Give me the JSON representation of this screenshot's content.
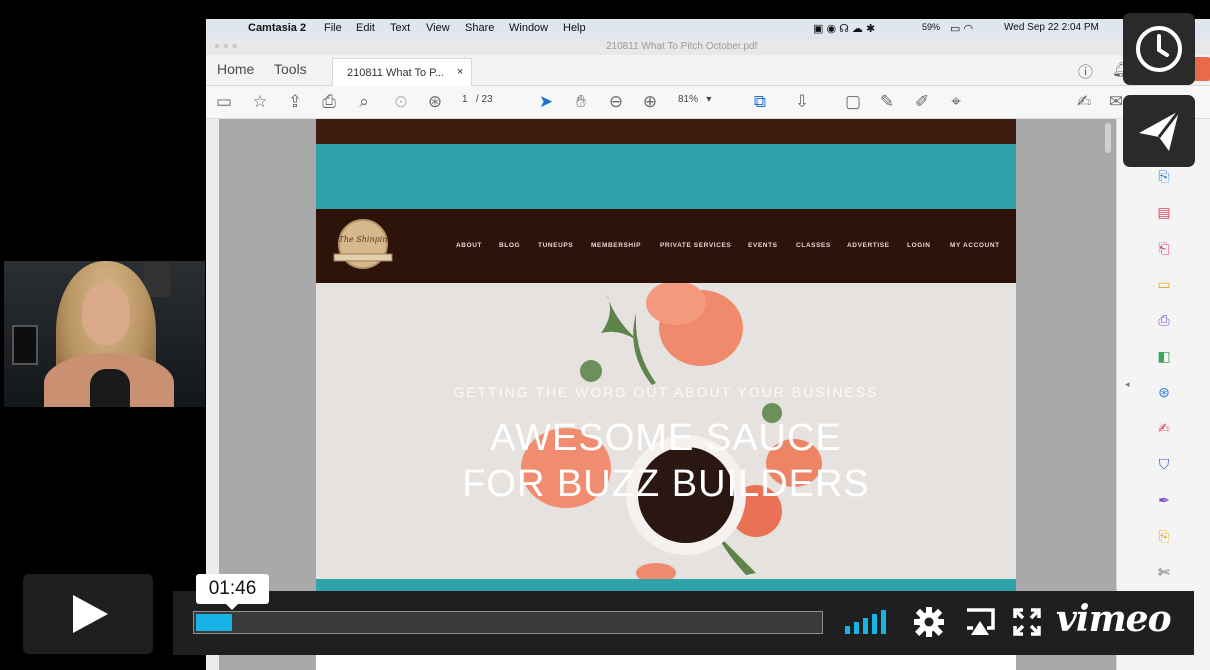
{
  "player": {
    "time_tooltip": "01:46",
    "progress": 0.057,
    "brand": "vimeo",
    "accent_color": "#17b3e6",
    "icons": [
      "play-icon",
      "volume-icon",
      "settings-icon",
      "airplay-icon",
      "fullscreen-icon",
      "clock-icon",
      "send-icon"
    ]
  },
  "mac_menubar": {
    "app": "Camtasia 2",
    "menus": [
      "File",
      "Edit",
      "Text",
      "View",
      "Share",
      "Window",
      "Help"
    ],
    "battery": "59%",
    "clock": "Wed Sep 22  2:04 PM"
  },
  "acrobat": {
    "window_title": "210811 What To Pitch October.pdf",
    "nav": [
      "Home",
      "Tools"
    ],
    "tab_label": "210811 What To P...",
    "tab_close": "×",
    "page_current": "1",
    "page_total": "/ 23",
    "zoom": "81%"
  },
  "pdf_page": {
    "nav_links": [
      "ABOUT",
      "BLOG",
      "TUNEUPS",
      "MEMBERSHIP",
      "PRIVATE SERVICES",
      "EVENTS",
      "CLASSES",
      "ADVERTISE",
      "LOGIN",
      "MY ACCOUNT"
    ],
    "logo_text": "The Shinpin",
    "tagline": "GETTING THE WORD OUT ABOUT YOUR BUSINESS",
    "headline_1": "AWESOME SAUCE",
    "headline_2": "FOR BUZZ BUILDERS",
    "colors": {
      "teal": "#2fa2aa",
      "brown": "#2e130a"
    }
  }
}
